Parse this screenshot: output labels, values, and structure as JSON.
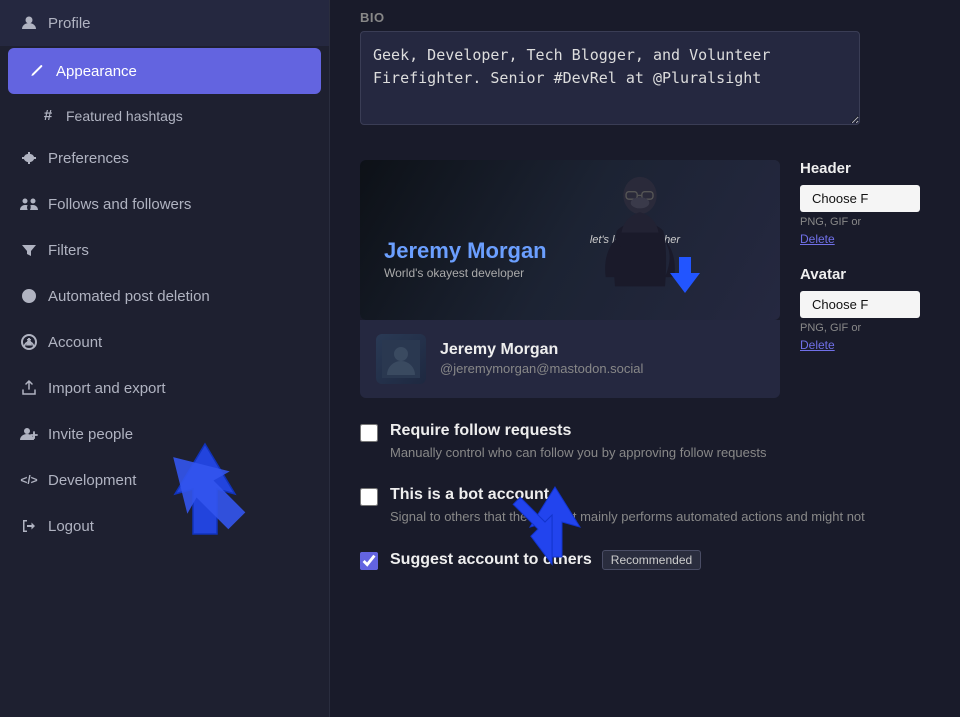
{
  "sidebar": {
    "items": [
      {
        "id": "profile",
        "label": "Profile",
        "icon": "👤",
        "active": false
      },
      {
        "id": "appearance",
        "label": "Appearance",
        "icon": "✏️",
        "active": true
      },
      {
        "id": "featured-hashtags",
        "label": "Featured hashtags",
        "icon": "#",
        "sub": true
      },
      {
        "id": "preferences",
        "label": "Preferences",
        "icon": "⚙️",
        "active": false
      },
      {
        "id": "follows-followers",
        "label": "Follows and followers",
        "icon": "👥",
        "active": false
      },
      {
        "id": "filters",
        "label": "Filters",
        "icon": "▼",
        "active": false
      },
      {
        "id": "automated-post-deletion",
        "label": "Automated post deletion",
        "icon": "↺",
        "active": false
      },
      {
        "id": "account",
        "label": "Account",
        "icon": "🔒",
        "active": false
      },
      {
        "id": "import-export",
        "label": "Import and export",
        "icon": "⬆",
        "active": false
      },
      {
        "id": "invite-people",
        "label": "Invite people",
        "icon": "👤+",
        "active": false
      },
      {
        "id": "development",
        "label": "Development",
        "icon": "</>",
        "active": false
      },
      {
        "id": "logout",
        "label": "Logout",
        "icon": "→",
        "active": false
      }
    ]
  },
  "bio": {
    "label": "BIO",
    "text": "Geek, Developer, Tech Blogger, and Volunteer Firefighter. Senior #DevRel at @Pluralsight"
  },
  "header_section": {
    "label": "Header",
    "choose_label": "Choose F",
    "file_hint": "PNG, GIF or",
    "delete_label": "Delete"
  },
  "avatar_section": {
    "label": "Avatar",
    "choose_label": "Choose F",
    "file_hint": "PNG, GIF or",
    "delete_label": "Delete"
  },
  "profile_preview": {
    "banner_name": "Jeremy Morgan",
    "banner_subtitle": "World's okayest developer",
    "banner_tagline": "let's learn together",
    "profile_name": "Jeremy Morgan",
    "profile_handle": "@jeremymorgan@mastodon.social"
  },
  "checkboxes": [
    {
      "id": "require-follow-requests",
      "checked": false,
      "label": "Require follow requests",
      "description": "Manually control who can follow you by approving follow requests"
    },
    {
      "id": "bot-account",
      "checked": false,
      "label": "This is a bot account",
      "description": "Signal to others that the account mainly performs automated actions and might not"
    },
    {
      "id": "suggest-account",
      "checked": true,
      "label": "Suggest account to others",
      "badge": "Recommended",
      "description": ""
    }
  ]
}
